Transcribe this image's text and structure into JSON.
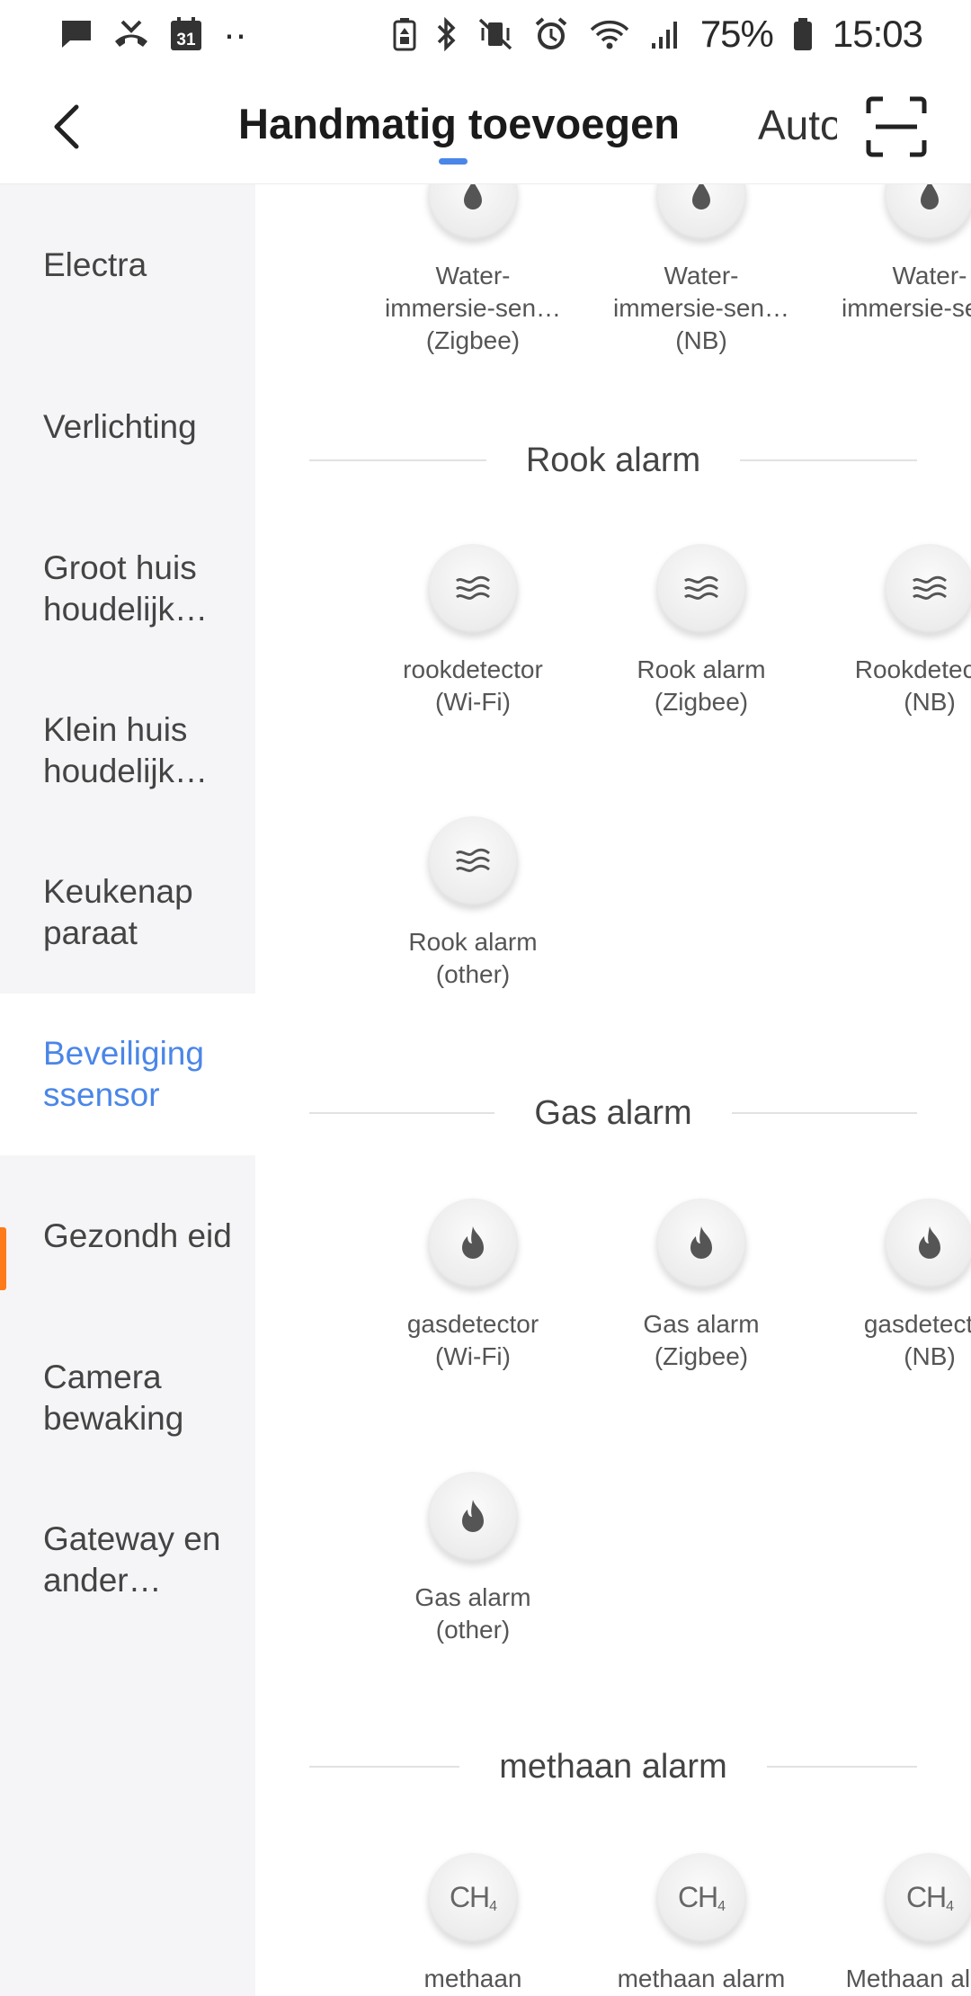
{
  "status_bar": {
    "calendar_day": "31",
    "more_dots": "··",
    "battery_percent": "75%",
    "time": "15:03"
  },
  "header": {
    "title": "Handmatig toevoegen",
    "auto_tab": "Auto"
  },
  "sidebar": {
    "items": [
      {
        "label": "Electra"
      },
      {
        "label": "Verlichting"
      },
      {
        "label": "Groot huis houdelijk…"
      },
      {
        "label": "Klein huis houdelijk…"
      },
      {
        "label": "Keukenap paraat"
      },
      {
        "label": "Beveiliging ssensor",
        "active": true
      },
      {
        "label": "Gezondh eid"
      },
      {
        "label": "Camera bewaking"
      },
      {
        "label": "Gateway en ander…"
      }
    ],
    "active_color": "#4a86e8",
    "indicator_color": "#ff7a1a"
  },
  "sections": {
    "water": {
      "devices": [
        {
          "icon": "water-drop-icon",
          "line1": "Water-",
          "line2": "immersie-sen…",
          "line3": "(Zigbee)"
        },
        {
          "icon": "water-drop-icon",
          "line1": "Water-",
          "line2": "immersie-sen…",
          "line3": "(NB)"
        },
        {
          "icon": "water-drop-icon",
          "line1": "Water-",
          "line2": "immersie-sen…",
          "line3": ""
        }
      ]
    },
    "smoke": {
      "title": "Rook alarm",
      "devices": [
        {
          "icon": "smoke-waves-icon",
          "line1": "rookdetector",
          "line2": "(Wi-Fi)"
        },
        {
          "icon": "smoke-waves-icon",
          "line1": "Rook alarm",
          "line2": "(Zigbee)"
        },
        {
          "icon": "smoke-waves-icon",
          "line1": "Rookdetector",
          "line2": "(NB)"
        },
        {
          "icon": "smoke-waves-icon",
          "line1": "Rook alarm",
          "line2": "(other)"
        }
      ]
    },
    "gas": {
      "title": "Gas alarm",
      "devices": [
        {
          "icon": "flame-icon",
          "line1": "gasdetector",
          "line2": "(Wi-Fi)"
        },
        {
          "icon": "flame-icon",
          "line1": "Gas alarm",
          "line2": "(Zigbee)"
        },
        {
          "icon": "flame-icon",
          "line1": "gasdetector",
          "line2": "(NB)"
        },
        {
          "icon": "flame-icon",
          "line1": "Gas alarm",
          "line2": "(other)"
        }
      ]
    },
    "methane": {
      "title": "methaan alarm",
      "icon_text": "CH",
      "icon_sub": "4",
      "devices": [
        {
          "icon": "ch4-icon",
          "line1": "methaan"
        },
        {
          "icon": "ch4-icon",
          "line1": "methaan alarm"
        },
        {
          "icon": "ch4-icon",
          "line1": "Methaan alarm"
        }
      ]
    }
  }
}
